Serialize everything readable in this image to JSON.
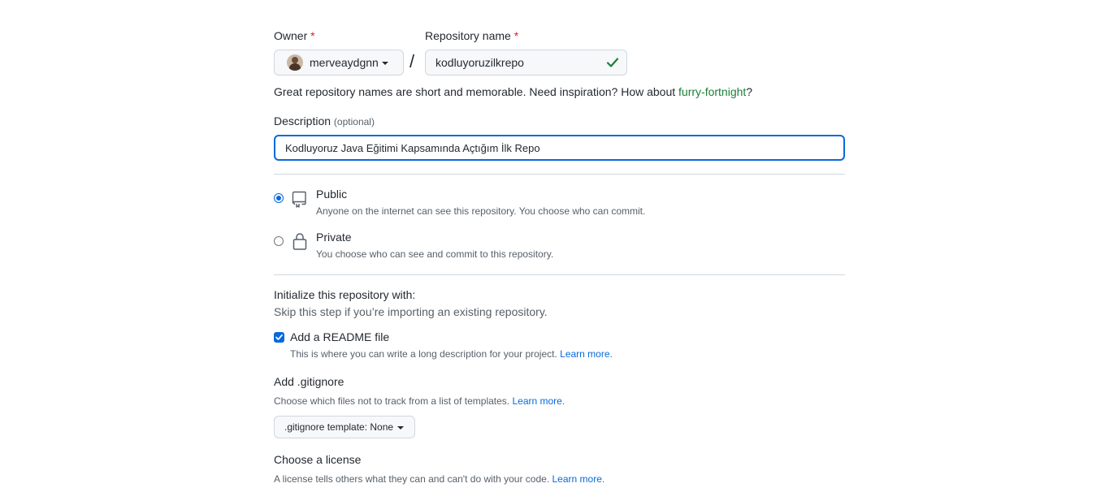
{
  "owner": {
    "label": "Owner",
    "required_mark": "*",
    "selected": "merveaydgnn"
  },
  "repo_name": {
    "label": "Repository name",
    "required_mark": "*",
    "value": "kodluyoruzilkrepo"
  },
  "separator": "/",
  "name_hint": {
    "prefix": "Great repository names are short and memorable. Need inspiration? How about ",
    "suggestion": "furry-fortnight",
    "suffix": "?"
  },
  "description": {
    "label": "Description",
    "optional": "(optional)",
    "value": "Kodluyoruz Java Eğitimi Kapsamında Açtığım İlk Repo"
  },
  "visibility": {
    "public": {
      "title": "Public",
      "desc": "Anyone on the internet can see this repository. You choose who can commit.",
      "selected": true
    },
    "private": {
      "title": "Private",
      "desc": "You choose who can see and commit to this repository.",
      "selected": false
    }
  },
  "init": {
    "title": "Initialize this repository with:",
    "subtitle": "Skip this step if you’re importing an existing repository.",
    "readme": {
      "label": "Add a README file",
      "desc": "This is where you can write a long description for your project. ",
      "link": "Learn more.",
      "checked": true
    }
  },
  "gitignore": {
    "title": "Add .gitignore",
    "desc": "Choose which files not to track from a list of templates. ",
    "link": "Learn more.",
    "button": ".gitignore template: None"
  },
  "license": {
    "title": "Choose a license",
    "desc": "A license tells others what they can and can't do with your code. ",
    "link": "Learn more."
  },
  "colors": {
    "accent": "#0969da",
    "success": "#1a7f37",
    "danger": "#cf222e",
    "border": "#d0d7de"
  }
}
